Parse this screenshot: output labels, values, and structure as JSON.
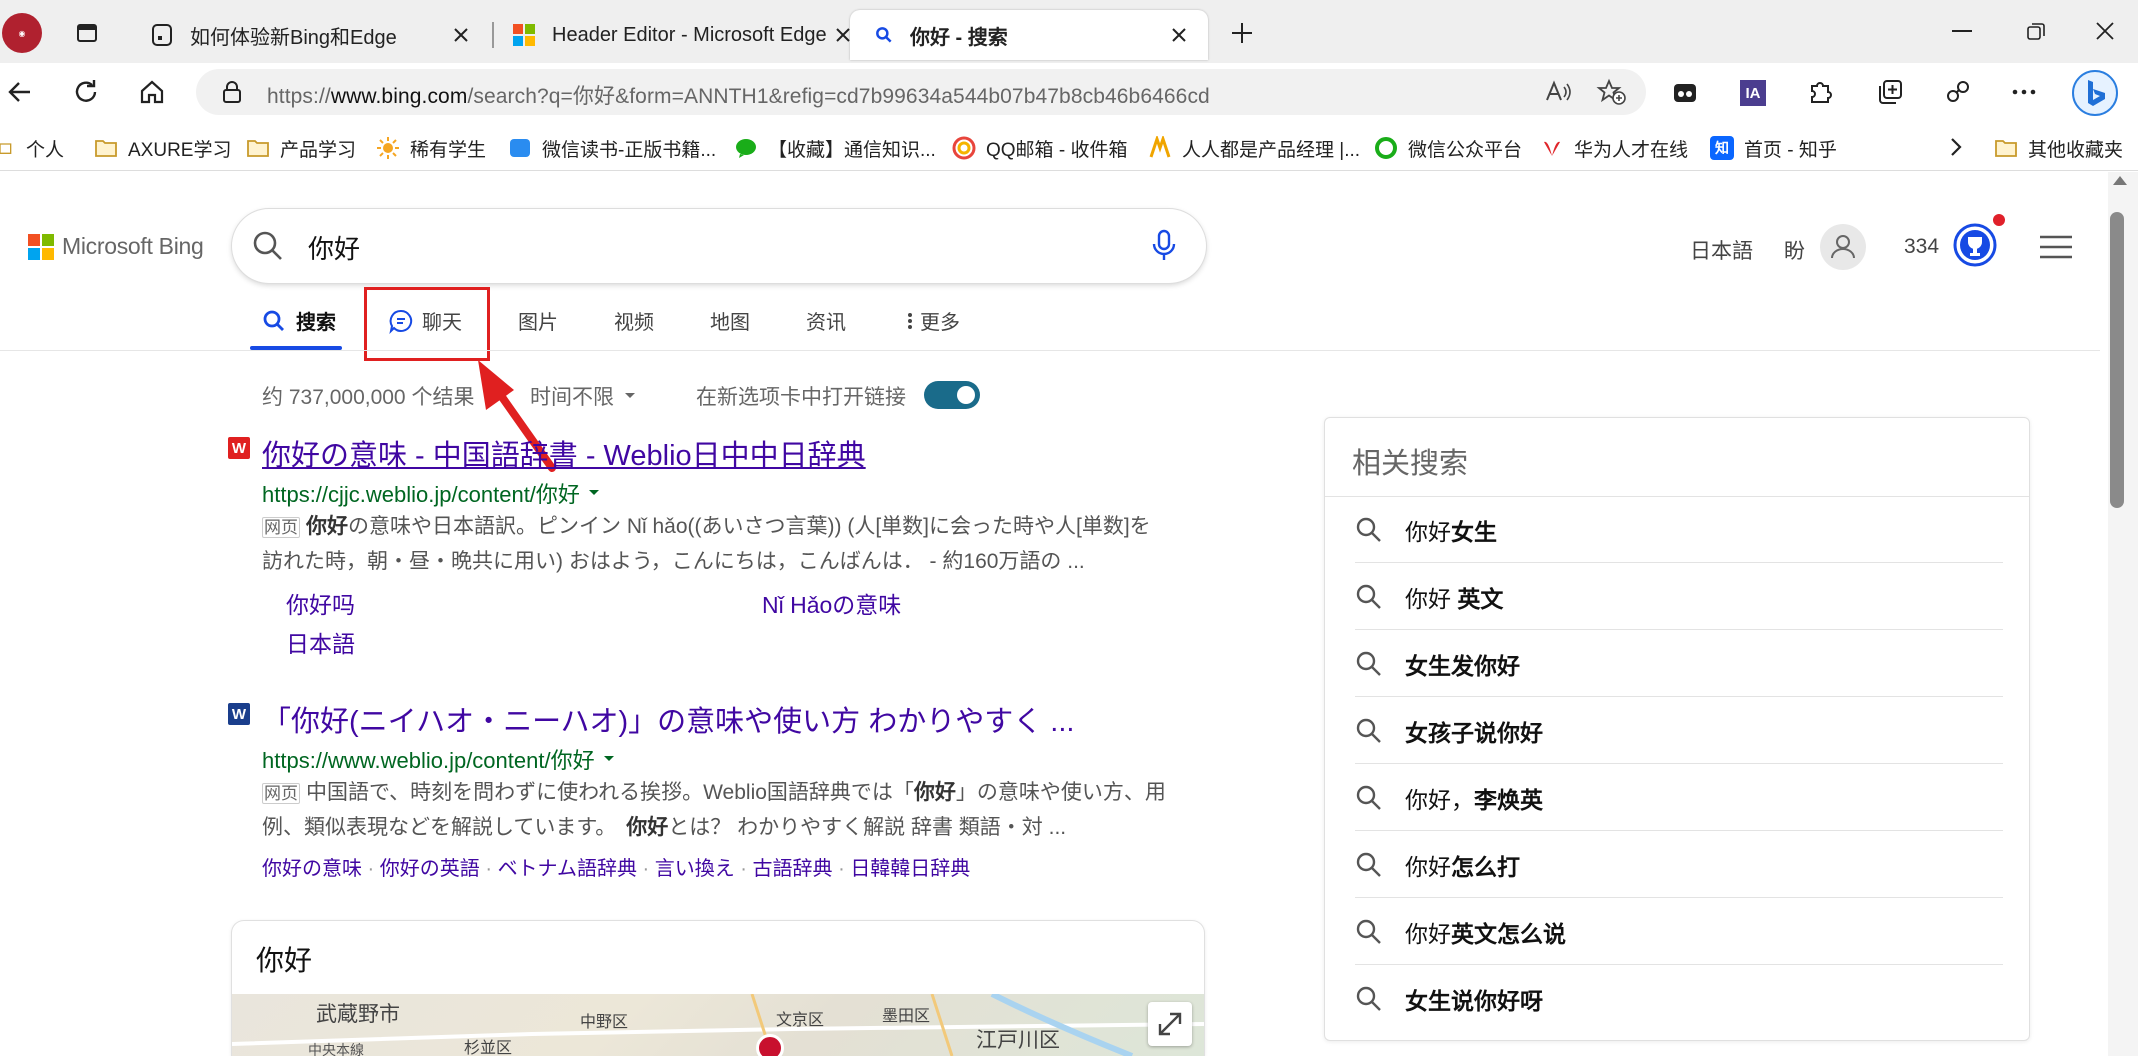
{
  "browser": {
    "tabs": [
      {
        "title": "如何体验新Bing和Edge"
      },
      {
        "title": "Header Editor - Microsoft Edge"
      },
      {
        "title": "你好 - 搜索"
      }
    ],
    "url": {
      "prefix": "https://",
      "domain": "www.bing.com",
      "rest": "/search?q=你好&form=ANNTH1&refig=cd7b99634a544b07b47b8cb46b6466cd"
    },
    "bookmarks": [
      "个人",
      "AXURE学习",
      "产品学习",
      "稀有学生",
      "微信读书-正版书籍...",
      "【收藏】通信知识...",
      "QQ邮箱 - 收件箱",
      "人人都是产品经理 |...",
      "微信公众平台",
      "华为人才在线",
      "首页 - 知乎"
    ],
    "other_bookmarks": "其他收藏夹"
  },
  "bing": {
    "logo_text": "Microsoft Bing",
    "query": "你好",
    "lang_link": "日本語",
    "user_name": "盼",
    "points": "334",
    "nav": [
      "搜索",
      "聊天",
      "图片",
      "视频",
      "地图",
      "资讯",
      "更多"
    ],
    "result_count": "约 737,000,000 个结果",
    "time_filter": "时间不限",
    "open_new_tab_label": "在新选项卡中打开链接"
  },
  "results": [
    {
      "title": "你好の意味 - 中国語辞書 - Weblio日中中日辞典",
      "url": "https://cjjc.weblio.jp/content/你好",
      "badge": "网页",
      "snippet_line1_bold": "你好",
      "snippet_line1": "の意味や日本語訳。ピンイン Nǐ hǎo((あいさつ言葉)) (人[単数]に会った時や人[単数]を",
      "snippet_line2": "訪れた時，朝・昼・晩共に用い) おはよう，こんにちは，こんばんは． - 約160万語の ...",
      "sublinks": [
        "你好吗",
        "Nǐ Hǎoの意味",
        "日本語"
      ]
    },
    {
      "title": "「你好(ニイハオ・ニーハオ)」の意味や使い方 わかりやすく ...",
      "url": "https://www.weblio.jp/content/你好",
      "badge": "网页",
      "snippet_line1_a": "中国語で、時刻を問わずに使われる挨拶。Weblio国語辞典では「",
      "snippet_line1_bold": "你好",
      "snippet_line1_b": "」の意味や使い方、用",
      "snippet_line2_a": "例、類似表現などを解説しています。",
      "snippet_line2_bold": "你好",
      "snippet_line2_b": "とは？ わかりやすく解説 辞書 類語・対 ...",
      "sublinks": [
        "你好の意味",
        "你好の英語",
        "ベトナム語辞典",
        "言い換え",
        "古語辞典",
        "日韓韓日辞典"
      ]
    }
  ],
  "map_card": {
    "title": "你好",
    "labels": [
      "武蔵野市",
      "中野区",
      "文京区",
      "墨田区",
      "杉並区",
      "中央本線",
      "江戸川区"
    ]
  },
  "related": {
    "heading": "相关搜索",
    "items": [
      {
        "plain": "你好",
        "bold": "女生"
      },
      {
        "plain": "你好 ",
        "bold": "英文"
      },
      {
        "plain": "",
        "bold": "女生发你好"
      },
      {
        "plain": "",
        "bold": "女孩子说你好"
      },
      {
        "plain": "你好，",
        "bold": "李焕英"
      },
      {
        "plain": "你好",
        "bold": "怎么打"
      },
      {
        "plain": "你好",
        "bold": "英文怎么说"
      },
      {
        "plain": "",
        "bold": "女生说你好呀"
      }
    ]
  },
  "colors": {
    "accent": "#174ae4",
    "highlight_box": "#e02020",
    "toggle": "#1a6b8a",
    "link": "#4007a2",
    "url_green": "#006621"
  }
}
